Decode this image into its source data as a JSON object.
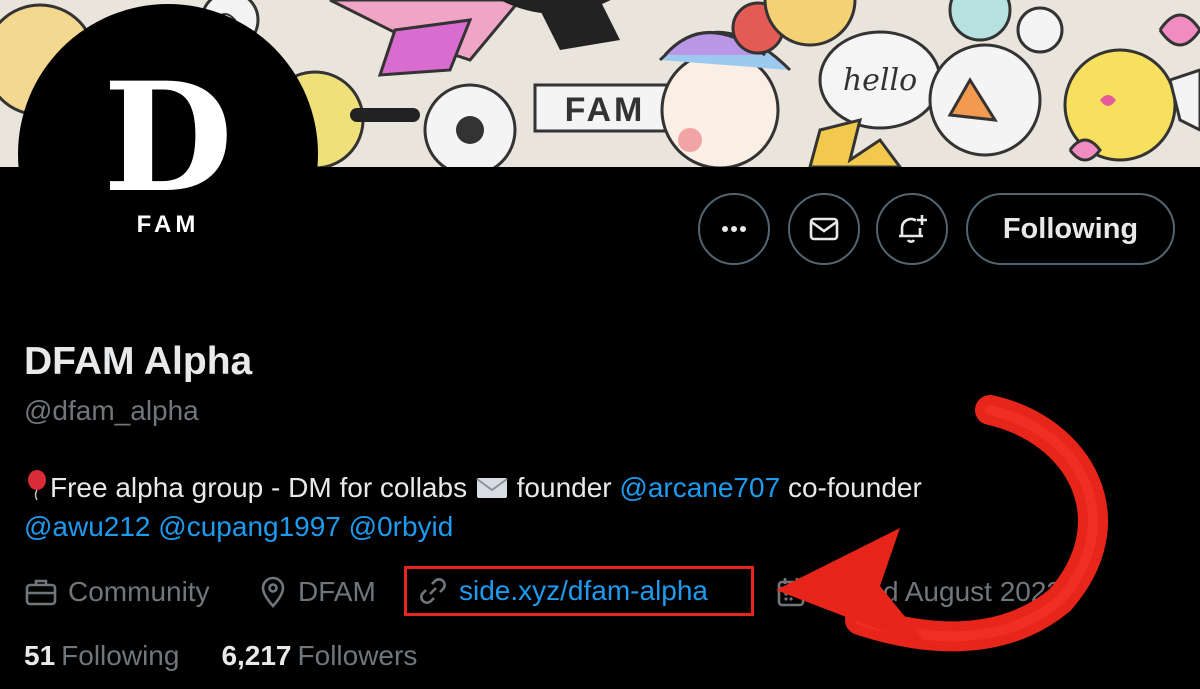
{
  "banner": {
    "sign_text": "FAM",
    "bubble_text": "hello"
  },
  "avatar": {
    "letter": "D",
    "caption": "FAM"
  },
  "actions": {
    "more_icon": "more-horizontal-icon",
    "message_icon": "envelope-icon",
    "notify_icon": "bell-plus-icon",
    "following_label": "Following"
  },
  "profile": {
    "display_name": "DFAM Alpha",
    "handle": "@dfam_alpha",
    "bio": {
      "balloon_icon": "balloon-emoji",
      "text_1": "Free alpha group - DM for collabs",
      "envelope_icon": "envelope-emoji",
      "text_2": "founder",
      "mention_1": "@arcane707",
      "text_3": "co-founder",
      "mention_2": "@awu212",
      "mention_3": "@cupang1997",
      "mention_4": "@0rbyid"
    },
    "meta": {
      "category": "Community",
      "location": "DFAM",
      "website": "side.xyz/dfam-alpha",
      "joined": "Joined August 2022"
    },
    "stats": {
      "following_count": "51",
      "following_label": "Following",
      "followers_count": "6,217",
      "followers_label": "Followers"
    }
  },
  "colors": {
    "background": "#000000",
    "text": "#e7e9ea",
    "muted": "#71767b",
    "link": "#1d9bf0",
    "annotation_red": "#e8251a",
    "button_border": "#536471"
  }
}
